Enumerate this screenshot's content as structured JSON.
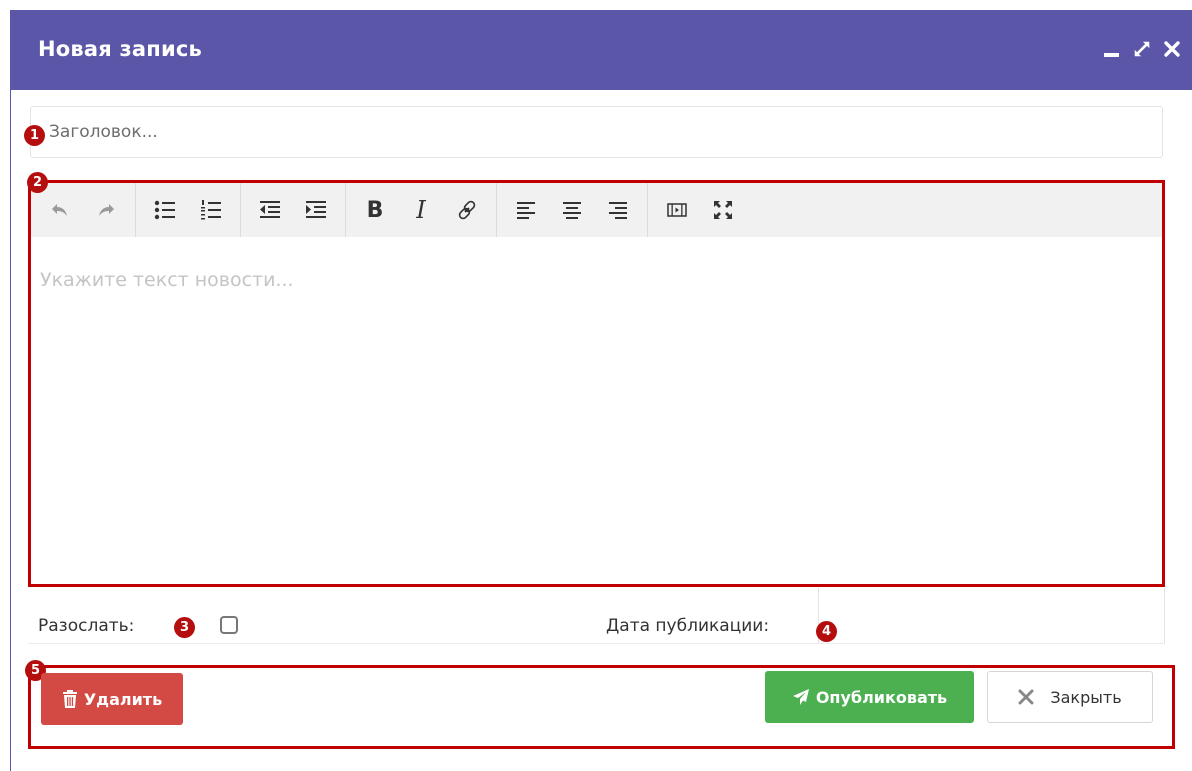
{
  "window": {
    "title": "Новая запись",
    "controls": [
      "minimize-icon",
      "maximize-icon",
      "close-icon"
    ],
    "accent_color": "#5b56a8"
  },
  "form": {
    "title_placeholder": "Заголовок...",
    "editor_placeholder": "Укажите текст новости...",
    "send_label": "Разослать:",
    "send_checked": false,
    "date_label": "Дата публикации:",
    "date_value": ""
  },
  "toolbar": {
    "icons": [
      "undo-icon",
      "redo-icon",
      "bulleted-list-icon",
      "numbered-list-icon",
      "outdent-icon",
      "indent-icon",
      "bold-icon",
      "italic-icon",
      "link-icon",
      "align-left-icon",
      "align-center-icon",
      "align-right-icon",
      "media-icon",
      "fullscreen-icon"
    ],
    "bold_glyph": "B",
    "italic_glyph": "I"
  },
  "annotations": {
    "badges": [
      "1",
      "2",
      "3",
      "4",
      "5"
    ],
    "highlight_color": "#c00000"
  },
  "buttons": {
    "delete_label": "Удалить",
    "publish_label": "Опубликовать",
    "close_label": "Закрыть",
    "delete_color": "#d34a44",
    "publish_color": "#4caf50"
  }
}
